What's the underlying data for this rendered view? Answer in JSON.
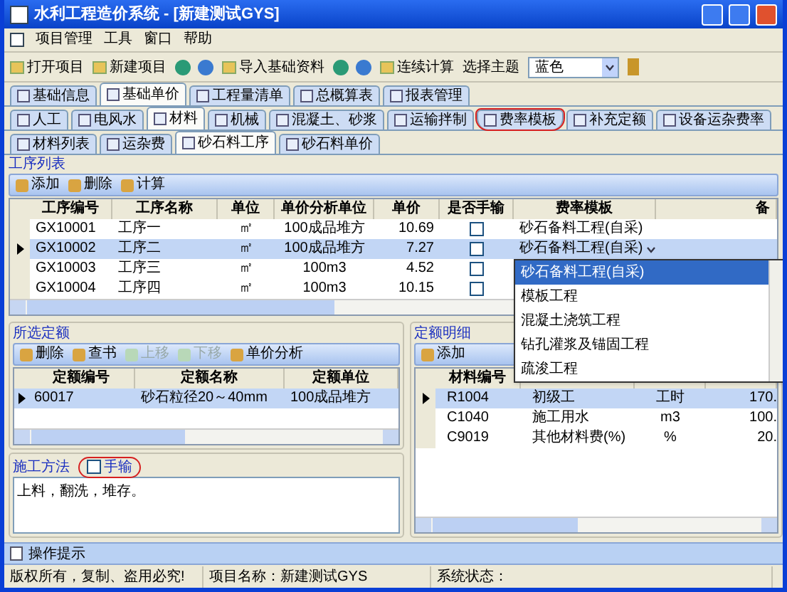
{
  "window": {
    "title": "水利工程造价系统 - [新建测试GYS]"
  },
  "menu": [
    "项目管理",
    "工具",
    "窗口",
    "帮助"
  ],
  "toolbar": {
    "buttons": [
      {
        "kind": "text",
        "label": "打开项目"
      },
      {
        "kind": "text",
        "label": "新建项目"
      },
      {
        "kind": "icons"
      },
      {
        "kind": "text",
        "label": "导入基础资料"
      },
      {
        "kind": "icons"
      },
      {
        "kind": "text",
        "label": "连续计算"
      }
    ],
    "theme_label": "选择主题",
    "theme_value": "蓝色"
  },
  "tabs_main": [
    {
      "label": "基础信息",
      "selected": false
    },
    {
      "label": "基础单价",
      "selected": true
    },
    {
      "label": "工程量清单",
      "selected": false
    },
    {
      "label": "总概算表",
      "selected": false
    },
    {
      "label": "报表管理",
      "selected": false
    }
  ],
  "tabs_sub": [
    {
      "label": "人工",
      "selected": false,
      "circled": false
    },
    {
      "label": "电风水",
      "selected": false,
      "circled": false
    },
    {
      "label": "材料",
      "selected": true,
      "circled": false
    },
    {
      "label": "机械",
      "selected": false,
      "circled": false
    },
    {
      "label": "混凝土、砂浆",
      "selected": false,
      "circled": false
    },
    {
      "label": "运输拌制",
      "selected": false,
      "circled": false
    },
    {
      "label": "费率模板",
      "selected": false,
      "circled": true
    },
    {
      "label": "补充定额",
      "selected": false,
      "circled": false
    },
    {
      "label": "设备运杂费率",
      "selected": false,
      "circled": false
    }
  ],
  "tabs_material": [
    {
      "label": "材料列表",
      "selected": false
    },
    {
      "label": "运杂费",
      "selected": false
    },
    {
      "label": "砂石料工序",
      "selected": true
    },
    {
      "label": "砂石料单价",
      "selected": false
    }
  ],
  "process_list": {
    "title": "工序列表",
    "buttons": [
      {
        "label": "添加",
        "disabled": false
      },
      {
        "label": "删除",
        "disabled": false
      },
      {
        "label": "计算",
        "disabled": false
      }
    ],
    "columns": [
      "工序编号",
      "工序名称",
      "单位",
      "单价分析单位",
      "单价",
      "是否手输",
      "费率模板",
      "备"
    ],
    "rows": [
      {
        "selected": false,
        "cells": [
          "GX10001",
          "工序一",
          "㎡",
          "100成品堆方",
          "10.69"
        ],
        "manual": false,
        "template": "砂石备料工程(自采)"
      },
      {
        "selected": true,
        "cells": [
          "GX10002",
          "工序二",
          "㎡",
          "100成品堆方",
          "7.27"
        ],
        "manual": false,
        "template": "砂石备料工程(自采)"
      },
      {
        "selected": false,
        "cells": [
          "GX10003",
          "工序三",
          "㎡",
          "100m3",
          "4.52"
        ],
        "manual": false
      },
      {
        "selected": false,
        "cells": [
          "GX10004",
          "工序四",
          "㎡",
          "100m3",
          "10.15"
        ],
        "manual": false
      }
    ],
    "dropdown": [
      {
        "label": "砂石备料工程(自采)",
        "selected": true
      },
      {
        "label": "模板工程",
        "selected": false
      },
      {
        "label": "混凝土浇筑工程",
        "selected": false
      },
      {
        "label": "钻孔灌浆及锚固工程",
        "selected": false
      },
      {
        "label": "疏浚工程",
        "selected": false
      }
    ]
  },
  "selected_quota": {
    "title": "所选定额",
    "buttons": [
      {
        "label": "删除",
        "disabled": false
      },
      {
        "label": "查书",
        "disabled": false
      },
      {
        "label": "上移",
        "disabled": true
      },
      {
        "label": "下移",
        "disabled": true
      },
      {
        "label": "单价分析",
        "disabled": false
      }
    ],
    "columns": [
      "定额编号",
      "定额名称",
      "定额单位"
    ],
    "rows": [
      {
        "selected": true,
        "cells": [
          "60017",
          "砂石粒径20～40mm",
          "100成品堆方"
        ]
      }
    ]
  },
  "method": {
    "title": "施工方法",
    "manual_label": "手输",
    "manual": false,
    "circled": true,
    "text": "上料，翻洗，堆存。"
  },
  "quota_detail": {
    "title": "定额明细",
    "buttons": [
      {
        "label": "添加",
        "disabled": false
      }
    ],
    "columns": [
      "材料编号"
    ],
    "rows": [
      {
        "selected": true,
        "cells": [
          "R1004",
          "初级工",
          "工时",
          "170."
        ]
      },
      {
        "selected": false,
        "cells": [
          "C1040",
          "施工用水",
          "m3",
          "100."
        ]
      },
      {
        "selected": false,
        "cells": [
          "C9019",
          "其他材料费(%)",
          "%",
          "20."
        ]
      }
    ]
  },
  "hint_bar": "操作提示",
  "status_bar": [
    "版权所有，复制、盗用必究!",
    "项目名称：新建测试GYS",
    "系统状态："
  ]
}
